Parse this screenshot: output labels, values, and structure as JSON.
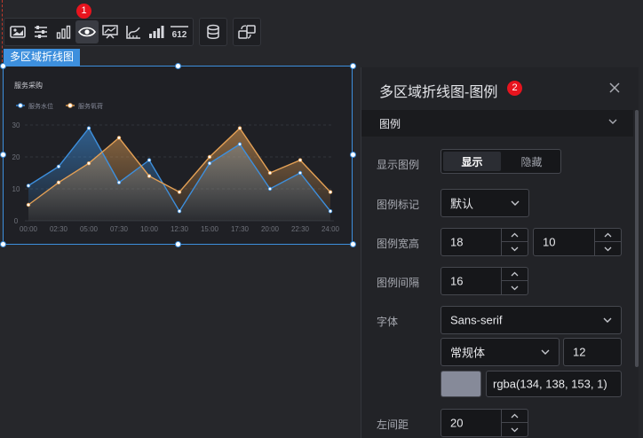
{
  "toolbar": {
    "icons": [
      "image-icon",
      "sliders-icon",
      "bar-chart-icon",
      "eye-target-icon",
      "monitor-chart-icon",
      "axis-icon",
      "bar-number-icon",
      "number-612-icon",
      "database-icon",
      "transfer-icon"
    ],
    "number_icon_text": "612",
    "badge": "1"
  },
  "component": {
    "label": "多区域折线图"
  },
  "chart_data": {
    "type": "area",
    "title": "服务采购",
    "x": [
      "00:00",
      "02:30",
      "05:00",
      "07:30",
      "10:00",
      "12:30",
      "15:00",
      "17:30",
      "20:00",
      "22:30",
      "24:00"
    ],
    "series": [
      {
        "name": "服务水位",
        "color": "#3d8fdd",
        "values": [
          11,
          17,
          29,
          12,
          19,
          3,
          18,
          24,
          10,
          15,
          3
        ]
      },
      {
        "name": "服务氧荷",
        "color": "#e3a055",
        "values": [
          5,
          12,
          18,
          26,
          14,
          9,
          20,
          29,
          15,
          19,
          9
        ]
      }
    ],
    "yticks": [
      0,
      10,
      20,
      30
    ],
    "ylim": [
      0,
      30
    ],
    "grid": true,
    "legend": "top-left"
  },
  "panel": {
    "title": "多区域折线图-图例",
    "badge": "2",
    "section": "图例",
    "rows": {
      "show_legend": {
        "label": "显示图例",
        "options": [
          "显示",
          "隐藏"
        ],
        "selected": "显示"
      },
      "legend_marker": {
        "label": "图例标记",
        "value": "默认"
      },
      "legend_size": {
        "label": "图例宽高",
        "width": "18",
        "height": "10"
      },
      "legend_gap": {
        "label": "图例间隔",
        "value": "16"
      },
      "font": {
        "label": "字体",
        "family": "Sans-serif",
        "style": "常规体",
        "size": "12",
        "color": "rgba(134, 138, 153, 1)"
      },
      "left_margin": {
        "label": "左间距",
        "value": "20"
      }
    }
  }
}
